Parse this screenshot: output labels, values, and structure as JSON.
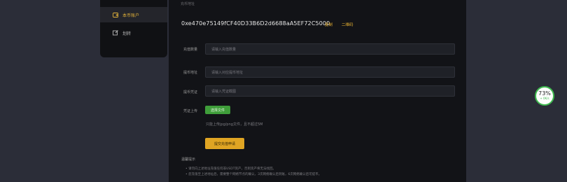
{
  "sidebar": {
    "items": [
      {
        "label": "本币账户",
        "icon": "wallet-icon",
        "active": true
      },
      {
        "label": "划转",
        "icon": "transfer-icon",
        "active": false
      }
    ]
  },
  "form": {
    "top_label": "充币地址",
    "address": "0xe470e75149fCF40D33B6D2d6688aA5EF72C5000",
    "copy_label": "复制",
    "qr_label": "二维码",
    "amount": {
      "label": "充值数量",
      "placeholder": "请输入充值数量"
    },
    "remark": {
      "label": "提币地址",
      "placeholder": "请输入对应提币地址"
    },
    "credential": {
      "label": "提币凭证",
      "placeholder": "请输入凭证截图"
    },
    "upload": {
      "label": "凭证上传",
      "button": "选择文件"
    },
    "upload_hint": "只能上传jpg/png文件，且不超过5M",
    "submit": "提交充值申请",
    "notes_title": "温馨提示",
    "notes": [
      "• 请勿向上述地址充值任何非USDT资产，否则资产将无法找回。",
      "• 您充值至上述地址后，需要整个网络节点的确认，3次网络确认后到账，6次网络确认后可提币。"
    ]
  },
  "badge": {
    "percent": "73%",
    "speed": "+ 0K/s"
  },
  "colors": {
    "accent": "#e0a523",
    "upload_green": "#3f9e3a",
    "badge_ring": "#3fb94f"
  }
}
